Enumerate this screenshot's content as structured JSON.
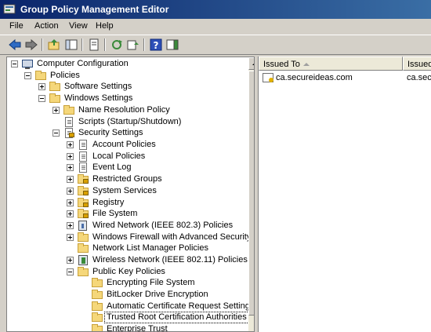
{
  "window": {
    "title": "Group Policy Management Editor"
  },
  "menu": [
    "File",
    "Action",
    "View",
    "Help"
  ],
  "toolbar": {
    "buttons": [
      "back-icon",
      "forward-icon",
      "up-folder-icon",
      "show-hide-tree-icon",
      "export-list-icon",
      "refresh-icon",
      "properties-icon",
      "help-icon",
      "show-hide-action-pane-icon"
    ]
  },
  "tree": {
    "computer_configuration": "Computer Configuration",
    "policies": "Policies",
    "software_settings": "Software Settings",
    "windows_settings": "Windows Settings",
    "name_resolution_policy": "Name Resolution Policy",
    "scripts": "Scripts (Startup/Shutdown)",
    "security_settings": "Security Settings",
    "account_policies": "Account Policies",
    "local_policies": "Local Policies",
    "event_log": "Event Log",
    "restricted_groups": "Restricted Groups",
    "system_services": "System Services",
    "registry": "Registry",
    "file_system": "File System",
    "wired_network": "Wired Network (IEEE 802.3) Policies",
    "windows_firewall": "Windows Firewall with Advanced Security",
    "network_list_manager": "Network List Manager Policies",
    "wireless_network": "Wireless Network (IEEE 802.11) Policies",
    "public_key_policies": "Public Key Policies",
    "encrypting_file_system": "Encrypting File System",
    "bitlocker": "BitLocker Drive Encryption",
    "auto_cert_request": "Automatic Certificate Request Settings",
    "trusted_root": "Trusted Root Certification Authorities",
    "enterprise_trust": "Enterprise Trust"
  },
  "list": {
    "columns": [
      "Issued To",
      "Issued"
    ],
    "rows": [
      {
        "issued_to": "ca.secureideas.com",
        "issued_by": "ca.secu"
      }
    ]
  }
}
